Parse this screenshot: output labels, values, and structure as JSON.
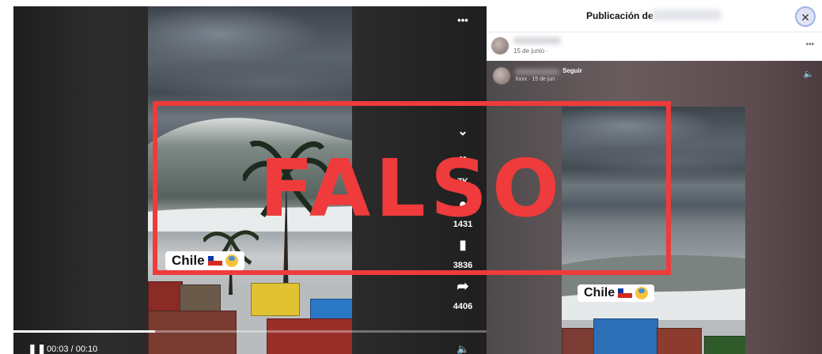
{
  "video": {
    "tag_label": "Chile",
    "more_glyph": "•••",
    "likes": "7K",
    "comments": "1431",
    "saves": "3836",
    "shares": "4406",
    "time": "00:03 / 00:10",
    "progress": 0.3
  },
  "facebook": {
    "header_title": "Publicación de",
    "close_glyph": "✕",
    "post_date": "15 de junio ·",
    "menu_glyph": "•••",
    "follow_label": "Seguir",
    "embedded_date": "Xxxx · 15 de jun ·",
    "tag_label": "Chile"
  },
  "overlay": {
    "label": "FALSO",
    "color": "#ef3b3b"
  }
}
